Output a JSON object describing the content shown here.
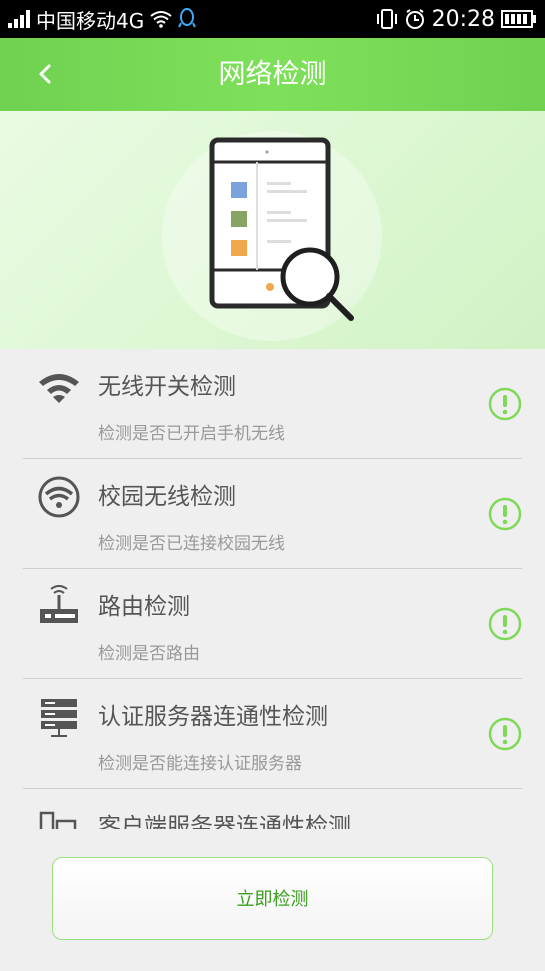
{
  "status_bar": {
    "carrier": "中国移动4G",
    "time": "20:28"
  },
  "header": {
    "title": "网络检测"
  },
  "checks": [
    {
      "icon": "wifi-icon",
      "title": "无线开关检测",
      "subtitle": "检测是否已开启手机无线"
    },
    {
      "icon": "campus-wifi-icon",
      "title": "校园无线检测",
      "subtitle": "检测是否已连接校园无线"
    },
    {
      "icon": "router-icon",
      "title": "路由检测",
      "subtitle": "检测是否路由"
    },
    {
      "icon": "server-icon",
      "title": "认证服务器连通性检测",
      "subtitle": "检测是否能连接认证服务器"
    },
    {
      "icon": "client-server-icon",
      "title": "客户端服务器连通性检测",
      "subtitle": ""
    }
  ],
  "actions": {
    "detect_now": "立即检测"
  },
  "colors": {
    "accent": "#72d552",
    "status_pending": "#7ed957"
  }
}
